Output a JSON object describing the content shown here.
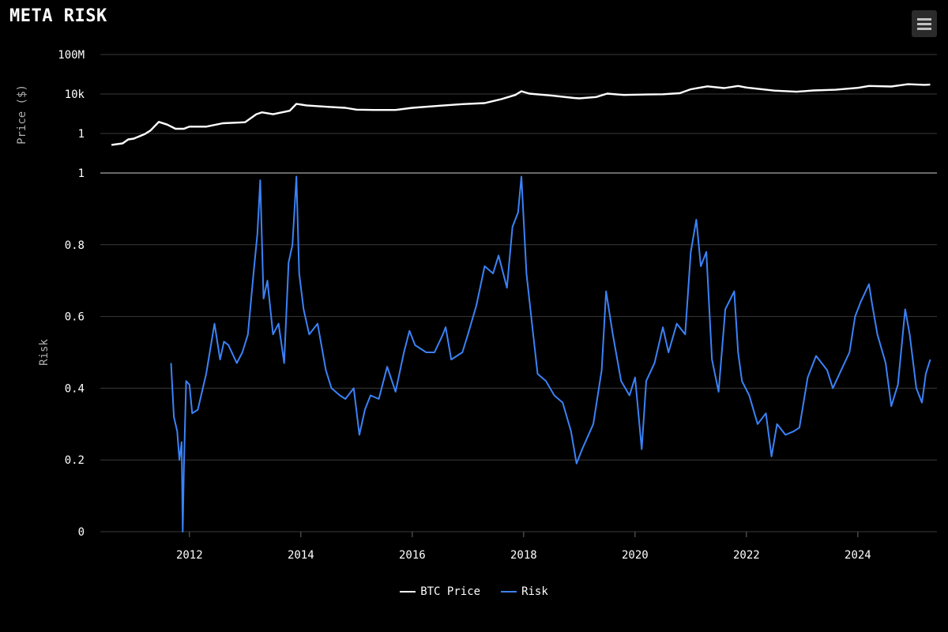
{
  "header": {
    "title": "META RISK",
    "menu_icon": "hamburger-menu-icon"
  },
  "colors": {
    "background": "#000000",
    "price": "#ffffff",
    "risk": "#3b82f6",
    "grid": "#3a3a3a"
  },
  "chart_data": [
    {
      "type": "line",
      "panel": "top",
      "ylabel": "Price ($)",
      "y_scale": "log",
      "y_ticks": [
        {
          "value": 1,
          "label": "1"
        },
        {
          "value": 10000,
          "label": "10k"
        },
        {
          "value": 100000000,
          "label": "100M"
        }
      ],
      "series": [
        {
          "name": "BTC Price",
          "x": [
            2010.6,
            2010.8,
            2010.9,
            2011.0,
            2011.2,
            2011.3,
            2011.45,
            2011.6,
            2011.75,
            2011.9,
            2012.0,
            2012.3,
            2012.6,
            2012.9,
            2013.0,
            2013.2,
            2013.3,
            2013.5,
            2013.8,
            2013.92,
            2014.1,
            2014.5,
            2014.8,
            2015.0,
            2015.3,
            2015.7,
            2016.0,
            2016.5,
            2016.9,
            2017.3,
            2017.6,
            2017.85,
            2017.96,
            2018.1,
            2018.5,
            2018.9,
            2019.0,
            2019.3,
            2019.5,
            2019.8,
            2020.2,
            2020.5,
            2020.8,
            2021.0,
            2021.3,
            2021.6,
            2021.85,
            2022.0,
            2022.5,
            2022.9,
            2023.2,
            2023.6,
            2024.0,
            2024.2,
            2024.6,
            2024.9,
            2025.2,
            2025.3
          ],
          "y": [
            0.07,
            0.1,
            0.25,
            0.3,
            0.9,
            2,
            15,
            8,
            3,
            3,
            5,
            5,
            11,
            13,
            14,
            90,
            140,
            90,
            200,
            1000,
            700,
            500,
            400,
            260,
            240,
            240,
            400,
            650,
            950,
            1200,
            3000,
            8000,
            19000,
            11000,
            7000,
            4000,
            3600,
            5000,
            11000,
            8000,
            9000,
            9500,
            12000,
            30000,
            60000,
            40000,
            65000,
            45000,
            22000,
            17000,
            23000,
            27000,
            42000,
            65000,
            58000,
            98000,
            85000,
            90000
          ]
        }
      ]
    },
    {
      "type": "line",
      "panel": "bottom",
      "ylabel": "Risk",
      "ylim": [
        0,
        1
      ],
      "y_ticks": [
        0,
        0.2,
        0.4,
        0.6,
        0.8,
        1
      ],
      "y_tick_labels": [
        "0",
        "0.2",
        "0.4",
        "0.6",
        "0.8",
        "1"
      ],
      "x_ticks": [
        2012,
        2014,
        2016,
        2018,
        2020,
        2022,
        2024
      ],
      "x_tick_labels": [
        "2012",
        "2014",
        "2016",
        "2018",
        "2020",
        "2022",
        "2024"
      ],
      "series": [
        {
          "name": "Risk",
          "x": [
            2011.67,
            2011.72,
            2011.78,
            2011.82,
            2011.86,
            2011.88,
            2011.9,
            2011.94,
            2012.0,
            2012.05,
            2012.15,
            2012.3,
            2012.45,
            2012.55,
            2012.62,
            2012.7,
            2012.85,
            2012.95,
            2013.05,
            2013.15,
            2013.22,
            2013.27,
            2013.33,
            2013.4,
            2013.5,
            2013.6,
            2013.7,
            2013.78,
            2013.85,
            2013.92,
            2013.97,
            2014.05,
            2014.15,
            2014.3,
            2014.45,
            2014.55,
            2014.7,
            2014.8,
            2014.95,
            2015.05,
            2015.15,
            2015.25,
            2015.4,
            2015.55,
            2015.7,
            2015.85,
            2015.95,
            2016.05,
            2016.25,
            2016.4,
            2016.55,
            2016.6,
            2016.7,
            2016.9,
            2017.0,
            2017.15,
            2017.3,
            2017.45,
            2017.55,
            2017.7,
            2017.8,
            2017.9,
            2017.96,
            2018.05,
            2018.15,
            2018.25,
            2018.4,
            2018.55,
            2018.7,
            2018.85,
            2018.95,
            2019.05,
            2019.25,
            2019.4,
            2019.48,
            2019.6,
            2019.75,
            2019.9,
            2020.0,
            2020.12,
            2020.2,
            2020.35,
            2020.5,
            2020.6,
            2020.75,
            2020.9,
            2021.0,
            2021.1,
            2021.18,
            2021.28,
            2021.38,
            2021.5,
            2021.62,
            2021.78,
            2021.85,
            2021.92,
            2022.05,
            2022.2,
            2022.35,
            2022.45,
            2022.55,
            2022.7,
            2022.85,
            2022.95,
            2023.1,
            2023.25,
            2023.35,
            2023.45,
            2023.55,
            2023.7,
            2023.85,
            2023.95,
            2024.05,
            2024.2,
            2024.25,
            2024.35,
            2024.5,
            2024.6,
            2024.72,
            2024.85,
            2024.93,
            2025.05,
            2025.15,
            2025.22,
            2025.3
          ],
          "y": [
            0.47,
            0.32,
            0.28,
            0.2,
            0.25,
            0.0,
            0.18,
            0.42,
            0.41,
            0.33,
            0.34,
            0.44,
            0.58,
            0.48,
            0.53,
            0.52,
            0.47,
            0.5,
            0.55,
            0.72,
            0.83,
            0.98,
            0.65,
            0.7,
            0.55,
            0.58,
            0.47,
            0.75,
            0.8,
            0.99,
            0.72,
            0.62,
            0.55,
            0.58,
            0.45,
            0.4,
            0.38,
            0.37,
            0.4,
            0.27,
            0.34,
            0.38,
            0.37,
            0.46,
            0.39,
            0.5,
            0.56,
            0.52,
            0.5,
            0.5,
            0.55,
            0.57,
            0.48,
            0.5,
            0.55,
            0.63,
            0.74,
            0.72,
            0.77,
            0.68,
            0.85,
            0.89,
            0.99,
            0.72,
            0.58,
            0.44,
            0.42,
            0.38,
            0.36,
            0.28,
            0.19,
            0.23,
            0.3,
            0.45,
            0.67,
            0.55,
            0.42,
            0.38,
            0.43,
            0.23,
            0.42,
            0.47,
            0.57,
            0.5,
            0.58,
            0.55,
            0.78,
            0.87,
            0.74,
            0.78,
            0.48,
            0.39,
            0.62,
            0.67,
            0.5,
            0.42,
            0.38,
            0.3,
            0.33,
            0.21,
            0.3,
            0.27,
            0.28,
            0.29,
            0.43,
            0.49,
            0.47,
            0.45,
            0.4,
            0.45,
            0.5,
            0.6,
            0.64,
            0.69,
            0.64,
            0.55,
            0.47,
            0.35,
            0.41,
            0.62,
            0.55,
            0.4,
            0.36,
            0.44,
            0.48
          ]
        }
      ]
    }
  ]
}
